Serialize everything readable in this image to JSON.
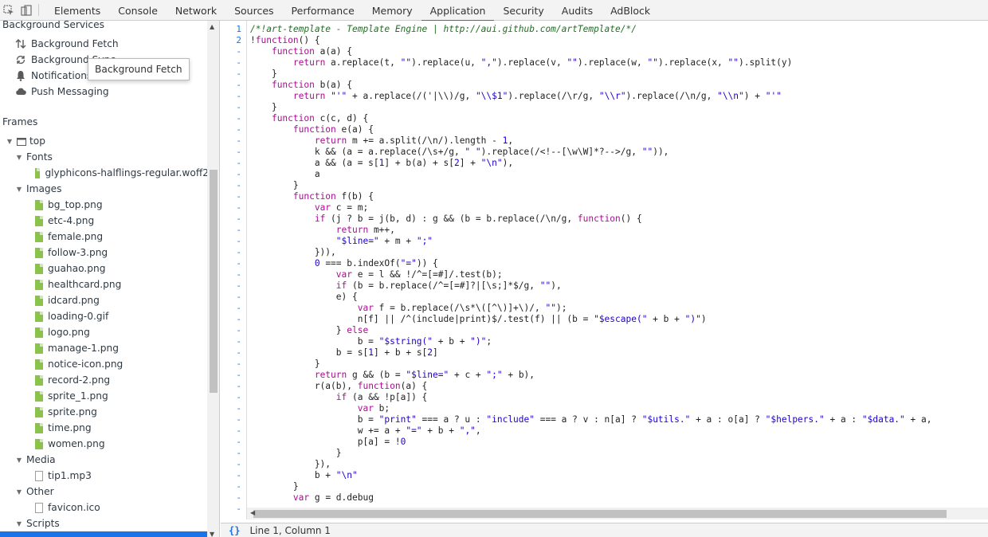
{
  "toolbar": {
    "icons": [
      "inspect-icon",
      "device-toggle-icon"
    ],
    "tabs": [
      {
        "label": "Elements"
      },
      {
        "label": "Console"
      },
      {
        "label": "Network"
      },
      {
        "label": "Sources"
      },
      {
        "label": "Performance"
      },
      {
        "label": "Memory"
      },
      {
        "label": "Application",
        "active": true
      },
      {
        "label": "Security"
      },
      {
        "label": "Audits"
      },
      {
        "label": "AdBlock"
      }
    ]
  },
  "sidebar": {
    "background_services": {
      "title": "Background Services",
      "items": [
        {
          "label": "Background Fetch",
          "icon": "background-fetch-icon"
        },
        {
          "label": "Background Sync",
          "icon": "sync-icon"
        },
        {
          "label": "Notifications",
          "icon": "bell-icon"
        },
        {
          "label": "Push Messaging",
          "icon": "cloud-icon"
        }
      ]
    },
    "tooltip": "Background Fetch",
    "frames": {
      "title": "Frames",
      "top_label": "top",
      "fonts": {
        "label": "Fonts",
        "files": [
          "glyphicons-halflings-regular.woff2"
        ]
      },
      "images": {
        "label": "Images",
        "files": [
          "bg_top.png",
          "etc-4.png",
          "female.png",
          "follow-3.png",
          "guahao.png",
          "healthcard.png",
          "idcard.png",
          "loading-0.gif",
          "logo.png",
          "manage-1.png",
          "notice-icon.png",
          "record-2.png",
          "sprite_1.png",
          "sprite.png",
          "time.png",
          "women.png"
        ]
      },
      "media": {
        "label": "Media",
        "files": [
          "tip1.mp3"
        ]
      },
      "other": {
        "label": "Other",
        "files": [
          "favicon.ico"
        ]
      },
      "scripts": {
        "label": "Scripts"
      }
    }
  },
  "editor": {
    "line_numbers": [
      "1",
      "2"
    ],
    "gutter_dash": "-",
    "lines": [
      "/*!art-template - Template Engine | http://aui.github.com/artTemplate/*/",
      "!function() {",
      "    function a(a) {",
      "        return a.replace(t, \"\").replace(u, \",\").replace(v, \"\").replace(w, \"\").replace(x, \"\").split(y)",
      "    }",
      "    function b(a) {",
      "        return \"'\" + a.replace(/('|\\\\)/g, \"\\\\$1\").replace(/\\r/g, \"\\\\r\").replace(/\\n/g, \"\\\\n\") + \"'\"",
      "    }",
      "    function c(c, d) {",
      "        function e(a) {",
      "            return m += a.split(/\\n/).length - 1,",
      "            k && (a = a.replace(/\\s+/g, \" \").replace(/<!--[\\w\\W]*?-->/g, \"\")),",
      "            a && (a = s[1] + b(a) + s[2] + \"\\n\"),",
      "            a",
      "        }",
      "        function f(b) {",
      "            var c = m;",
      "            if (j ? b = j(b, d) : g && (b = b.replace(/\\n/g, function() {",
      "                return m++,",
      "                \"$line=\" + m + \";\"",
      "            })),",
      "            0 === b.indexOf(\"=\")) {",
      "                var e = l && !/^=[=#]/.test(b);",
      "                if (b = b.replace(/^=[=#]?|[\\s;]*$/g, \"\"),",
      "                e) {",
      "                    var f = b.replace(/\\s*\\([^\\)]+\\)/, \"\");",
      "                    n[f] || /^(include|print)$/.test(f) || (b = \"$escape(\" + b + \")\")",
      "                } else",
      "                    b = \"$string(\" + b + \")\";",
      "                b = s[1] + b + s[2]",
      "            }",
      "            return g && (b = \"$line=\" + c + \";\" + b),",
      "            r(a(b), function(a) {",
      "                if (a && !p[a]) {",
      "                    var b;",
      "                    b = \"print\" === a ? u : \"include\" === a ? v : n[a] ? \"$utils.\" + a : o[a] ? \"$helpers.\" + a : \"$data.\" + a,",
      "                    w += a + \"=\" + b + \",\",",
      "                    p[a] = !0",
      "                }",
      "            }),",
      "            b + \"\\n\"",
      "        }",
      "        var g = d.debug"
    ]
  },
  "status": {
    "braces": "{}",
    "position": "Line 1, Column 1"
  }
}
